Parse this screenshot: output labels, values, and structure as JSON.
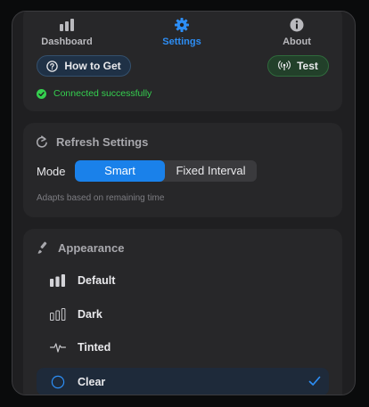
{
  "tabs": [
    {
      "label": "Dashboard",
      "icon": "bar-chart-icon",
      "active": false
    },
    {
      "label": "Settings",
      "icon": "gear-icon",
      "active": true
    },
    {
      "label": "About",
      "icon": "info-icon",
      "active": false
    }
  ],
  "connection": {
    "how_to_get_label": "How to Get",
    "test_label": "Test",
    "status_text": "Connected successfully",
    "status_color": "#35d04f"
  },
  "refresh": {
    "title": "Refresh Settings",
    "mode_label": "Mode",
    "options": [
      "Smart",
      "Fixed Interval"
    ],
    "selected": "Smart",
    "hint": "Adapts based on remaining time"
  },
  "appearance": {
    "title": "Appearance",
    "themes": [
      {
        "label": "Default",
        "icon": "bars-filled-icon"
      },
      {
        "label": "Dark",
        "icon": "bars-outline-icon"
      },
      {
        "label": "Tinted",
        "icon": "waveform-icon"
      },
      {
        "label": "Clear",
        "icon": "circle-icon"
      }
    ],
    "selected": "Clear"
  },
  "colors": {
    "accent": "#2d8ef5",
    "success": "#35d04f"
  }
}
